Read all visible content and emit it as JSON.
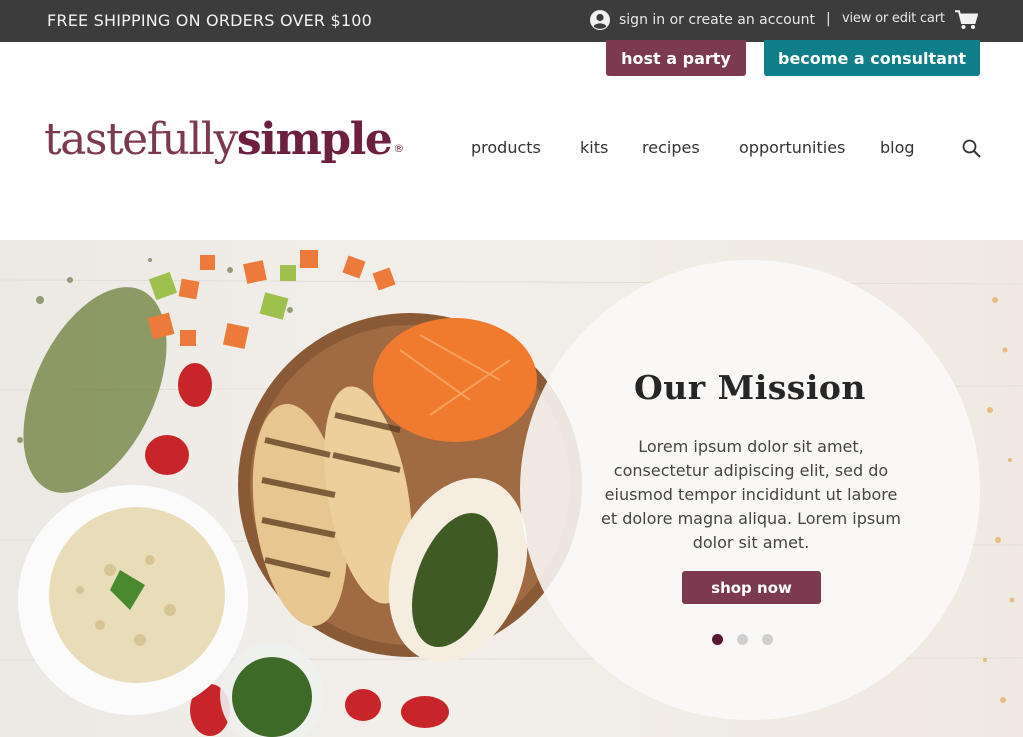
{
  "topbar": {
    "promo": "FREE SHIPPING ON ORDERS OVER $100",
    "account_link": "sign in or create an account",
    "separator": "|",
    "cart_link": "view or edit cart",
    "user_icon": "user-circle-icon",
    "cart_icon": "shopping-cart-icon"
  },
  "actions": {
    "host": "host a party",
    "consultant": "become a consultant"
  },
  "logo": {
    "part1": "tastefully",
    "part2": "simple",
    "registered": "®"
  },
  "nav": {
    "items": [
      "products",
      "kits",
      "recipes",
      "opportunities",
      "blog"
    ],
    "search_icon": "search-icon"
  },
  "hero": {
    "title": "Our Mission",
    "body": "Lorem ipsum dolor sit amet, consectetur adipiscing elit, sed do eiusmod tempor incididunt ut labore et dolore magna aliqua.  Lorem ipsum dolor sit amet.",
    "cta": "shop now",
    "slides": 3,
    "active_slide": 1
  },
  "colors": {
    "topbar": "#3c3c3c",
    "brand_plum": "#7b3a4f",
    "brand_teal": "#0f7e88"
  }
}
